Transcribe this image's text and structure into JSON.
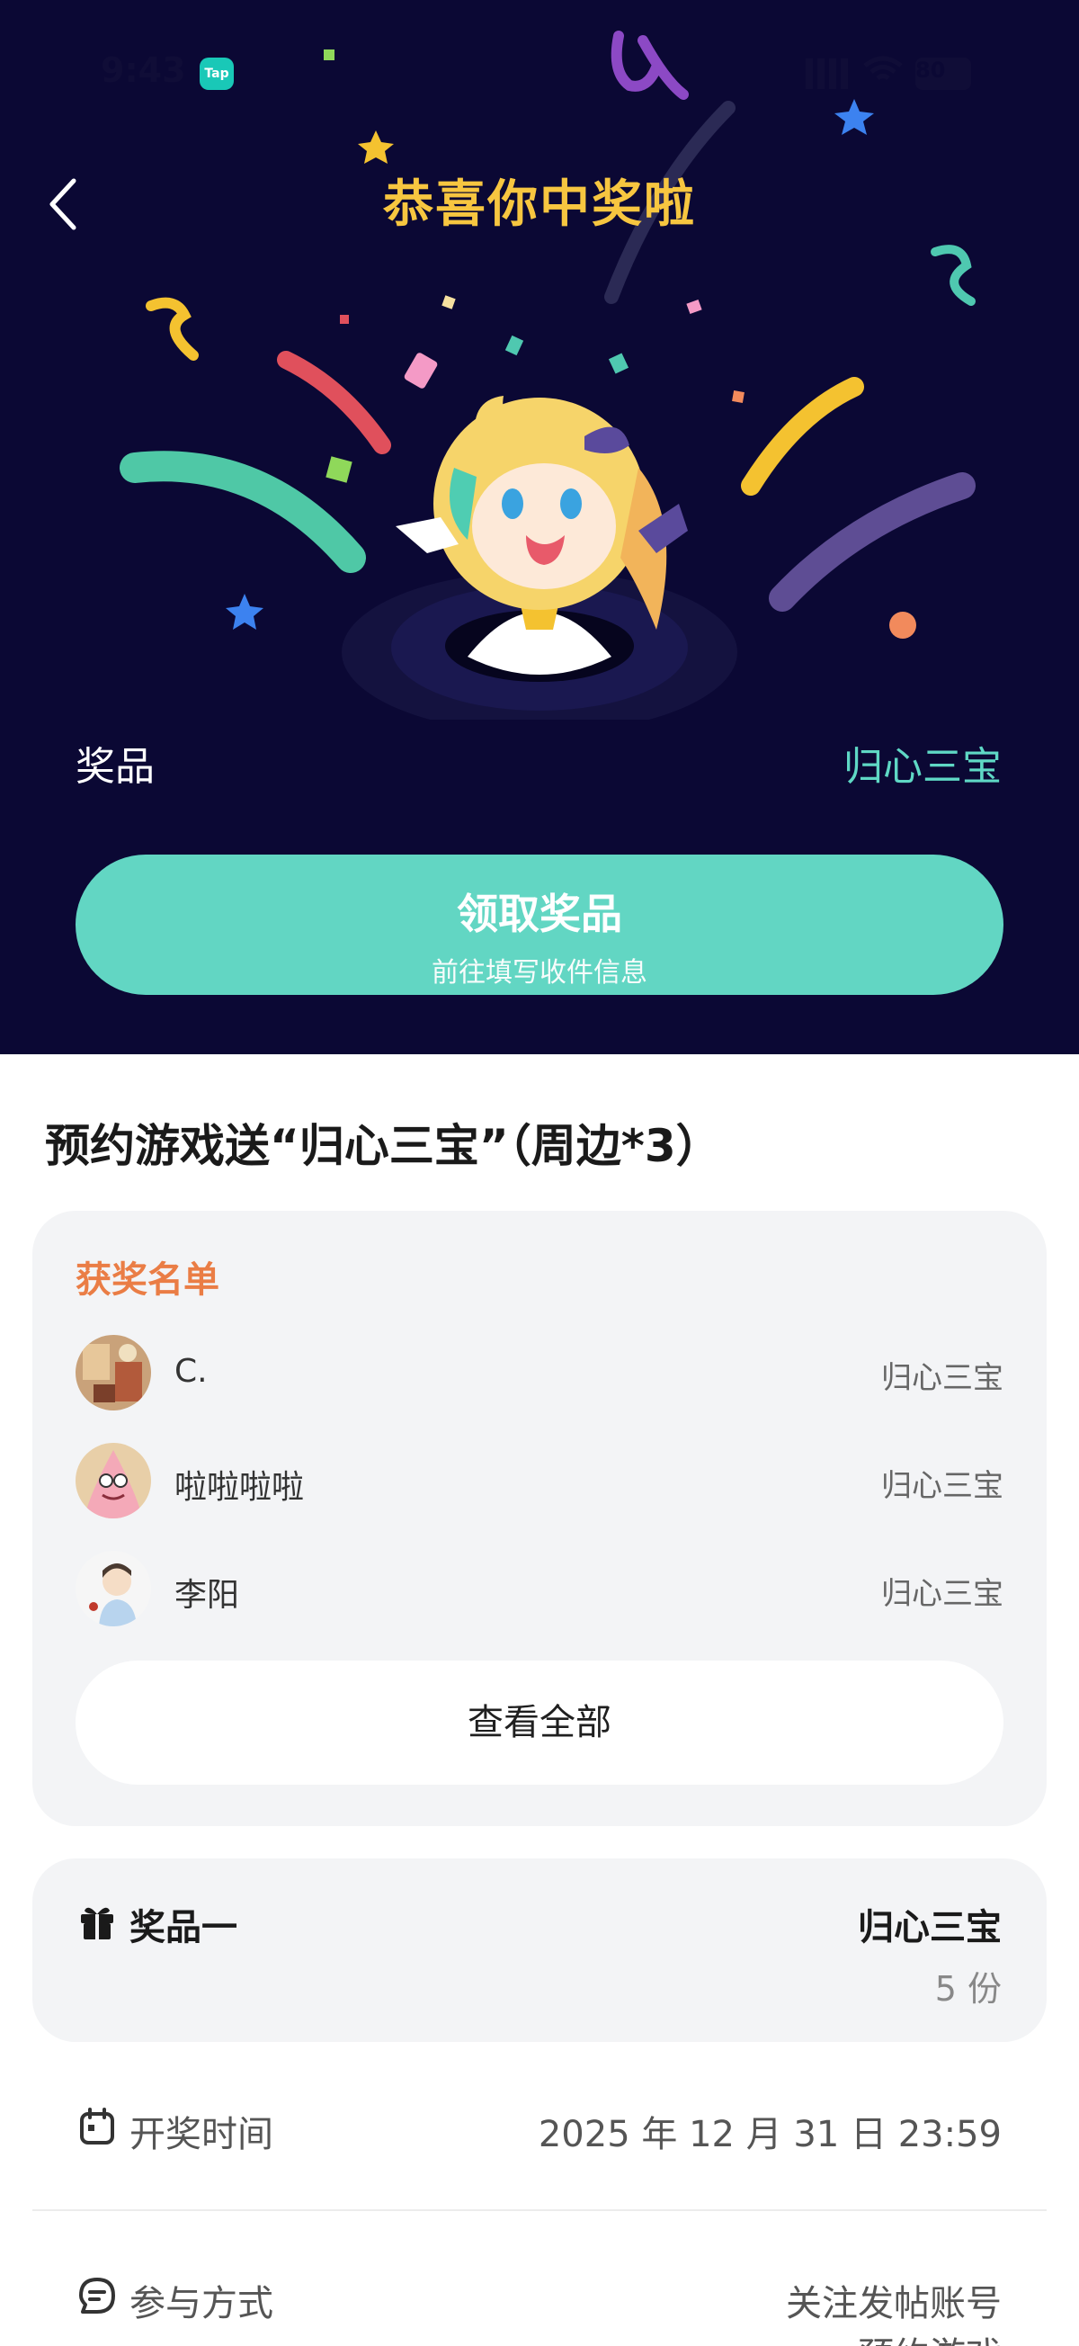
{
  "status_bar": {
    "time": "9:43",
    "app_badge": "Tap",
    "battery": "80"
  },
  "header": {
    "title": "恭喜你中奖啦"
  },
  "prize_banner": {
    "label": "奖品",
    "value": "归心三宝"
  },
  "claim_button": {
    "label": "领取奖品",
    "sub_label": "前往填写收件信息"
  },
  "post": {
    "title": "预约游戏送“归心三宝”（周边*3）"
  },
  "winners": {
    "heading": "获奖名单",
    "list": [
      {
        "name": "C.",
        "prize": "归心三宝"
      },
      {
        "name": "啦啦啦啦",
        "prize": "归心三宝"
      },
      {
        "name": "李阳",
        "prize": "归心三宝"
      }
    ],
    "view_all_label": "查看全部"
  },
  "prize_item": {
    "label": "奖品一",
    "name": "归心三宝",
    "quantity": "5 份"
  },
  "draw_time": {
    "label": "开奖时间",
    "value": "2025 年 12 月 31 日 23:59"
  },
  "participation": {
    "label": "参与方式",
    "value": "关注发帖账号",
    "value_2": "预约游戏"
  },
  "colors": {
    "hero_bg": "#0b0834",
    "title_gold": "#f7c640",
    "accent_teal": "#62d6c3",
    "heading_orange": "#ea7d45"
  }
}
